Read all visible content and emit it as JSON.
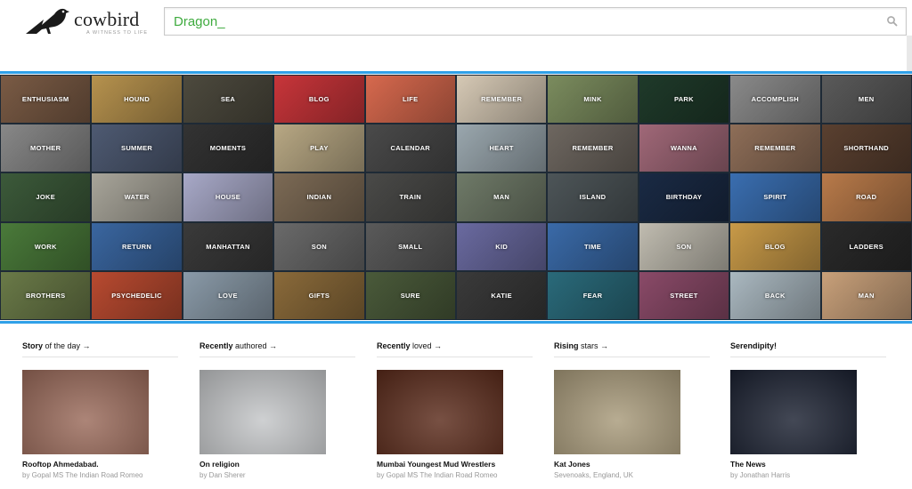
{
  "header": {
    "logo_name": "cowbird",
    "logo_tagline": "A WITNESS TO LIFE",
    "search_value": "Dragon_"
  },
  "colors": {
    "accent_blue": "#2fa0e8",
    "search_green": "#3fab3f"
  },
  "grid_tiles": [
    {
      "label": "ENTHUSIASM",
      "bg": "#7a5b45"
    },
    {
      "label": "HOUND",
      "bg": "#b6924e"
    },
    {
      "label": "SEA",
      "bg": "#4d4a3e"
    },
    {
      "label": "BLOG",
      "bg": "#c8353a"
    },
    {
      "label": "LIFE",
      "bg": "#d7694e"
    },
    {
      "label": "REMEMBER",
      "bg": "#d6c9b5"
    },
    {
      "label": "MINK",
      "bg": "#7b8c5e"
    },
    {
      "label": "PARK",
      "bg": "#1f3a2a"
    },
    {
      "label": "ACCOMPLISH",
      "bg": "#8a8a8a"
    },
    {
      "label": "MEN",
      "bg": "#5a5a5a"
    },
    {
      "label": "MOTHER",
      "bg": "#888888"
    },
    {
      "label": "SUMMER",
      "bg": "#4e5a72"
    },
    {
      "label": "MOMENTS",
      "bg": "#333333"
    },
    {
      "label": "PLAY",
      "bg": "#b8a884"
    },
    {
      "label": "CALENDAR",
      "bg": "#4a4a4a"
    },
    {
      "label": "HEART",
      "bg": "#9aa7ae"
    },
    {
      "label": "REMEMBER",
      "bg": "#6e6760"
    },
    {
      "label": "WANNA",
      "bg": "#a06878"
    },
    {
      "label": "REMEMBER",
      "bg": "#8e6e58"
    },
    {
      "label": "SHORTHAND",
      "bg": "#5a4030"
    },
    {
      "label": "JOKE",
      "bg": "#3c5a3a"
    },
    {
      "label": "WATER",
      "bg": "#a8a59a"
    },
    {
      "label": "HOUSE",
      "bg": "#a8a9c8"
    },
    {
      "label": "INDIAN",
      "bg": "#7c6a55"
    },
    {
      "label": "TRAIN",
      "bg": "#4a4a48"
    },
    {
      "label": "MAN",
      "bg": "#6f7a68"
    },
    {
      "label": "ISLAND",
      "bg": "#4d5558"
    },
    {
      "label": "BIRTHDAY",
      "bg": "#1a2a44"
    },
    {
      "label": "SPIRIT",
      "bg": "#3a6eb0"
    },
    {
      "label": "ROAD",
      "bg": "#b87a4a"
    },
    {
      "label": "WORK",
      "bg": "#4a7a3a"
    },
    {
      "label": "RETURN",
      "bg": "#3a66a0"
    },
    {
      "label": "MANHATTAN",
      "bg": "#3a3a3a"
    },
    {
      "label": "SON",
      "bg": "#6a6a6a"
    },
    {
      "label": "SMALL",
      "bg": "#5a5a5a"
    },
    {
      "label": "KID",
      "bg": "#6a6aa0"
    },
    {
      "label": "TIME",
      "bg": "#3a6aa8"
    },
    {
      "label": "SON",
      "bg": "#c0bcb0"
    },
    {
      "label": "BLOG",
      "bg": "#c89a48"
    },
    {
      "label": "LADDERS",
      "bg": "#2a2a2a"
    },
    {
      "label": "BROTHERS",
      "bg": "#6a7a48"
    },
    {
      "label": "PSYCHEDELIC",
      "bg": "#b84a30"
    },
    {
      "label": "LOVE",
      "bg": "#8a9aa8"
    },
    {
      "label": "GIFTS",
      "bg": "#8a6a3a"
    },
    {
      "label": "SURE",
      "bg": "#4a5a3a"
    },
    {
      "label": "KATIE",
      "bg": "#3a3a3a"
    },
    {
      "label": "FEAR",
      "bg": "#2a6a7a"
    },
    {
      "label": "STREET",
      "bg": "#8a4a68"
    },
    {
      "label": "BACK",
      "bg": "#aab8c0"
    },
    {
      "label": "MAN",
      "bg": "#c8a07a"
    }
  ],
  "sections": [
    {
      "title_bold": "Story",
      "title_rest": " of the day →",
      "item_title": "Rooftop Ahmedabad.",
      "item_by": "by Gopal MS The Indian Road Romeo",
      "img_bg": "#9a6a5a"
    },
    {
      "title_bold": "Recently",
      "title_rest": " authored →",
      "item_title": "On religion",
      "item_by": "by Dan Sherer",
      "img_bg": "#c4c6c8"
    },
    {
      "title_bold": "Recently",
      "title_rest": " loved →",
      "item_title": "Mumbai Youngest Mud Wrestlers",
      "item_by": "by Gopal MS The Indian Road Romeo",
      "img_bg": "#5a2a1a"
    },
    {
      "title_bold": "Rising",
      "title_rest": " stars →",
      "item_title": "Kat Jones",
      "item_by": "Sevenoaks, England, UK",
      "img_bg": "#a89a7a"
    },
    {
      "title_bold": "Serendipity!",
      "title_rest": "",
      "item_title": "The News",
      "item_by": "by Jonathan Harris",
      "img_bg": "#1a2030"
    }
  ]
}
